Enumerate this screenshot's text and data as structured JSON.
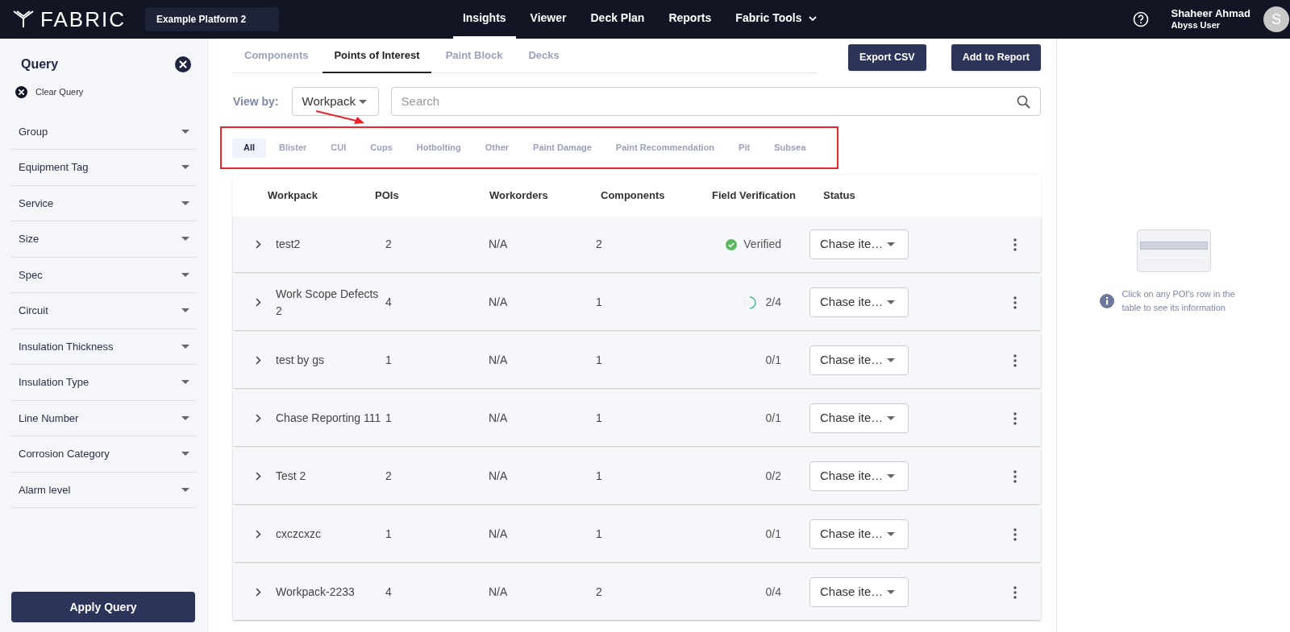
{
  "header": {
    "logo": "FABRIC",
    "platform": "Example Platform 2",
    "nav": [
      {
        "label": "Insights",
        "selected": true,
        "has_menu": false
      },
      {
        "label": "Viewer",
        "selected": false,
        "has_menu": false
      },
      {
        "label": "Deck Plan",
        "selected": false,
        "has_menu": false
      },
      {
        "label": "Reports",
        "selected": false,
        "has_menu": false
      },
      {
        "label": "Fabric Tools",
        "selected": false,
        "has_menu": true
      }
    ],
    "user": {
      "name": "Shaheer Ahmad",
      "role": "Abyss User",
      "initial": "S"
    }
  },
  "sidebar": {
    "title": "Query",
    "clear": "Clear Query",
    "filters": [
      "Group",
      "Equipment Tag",
      "Service",
      "Size",
      "Spec",
      "Circuit",
      "Insulation Thickness",
      "Insulation Type",
      "Line Number",
      "Corrosion Category",
      "Alarm level"
    ],
    "apply": "Apply Query"
  },
  "tabs": [
    {
      "label": "Components",
      "selected": false
    },
    {
      "label": "Points of Interest",
      "selected": true
    },
    {
      "label": "Paint Block",
      "selected": false
    },
    {
      "label": "Decks",
      "selected": false
    }
  ],
  "buttons": [
    "Export CSV",
    "Add to Report"
  ],
  "view_by": {
    "label": "View by:",
    "value": "Workpack"
  },
  "search": {
    "placeholder": "Search"
  },
  "categories": [
    {
      "label": "All",
      "selected": true
    },
    {
      "label": "Blister",
      "selected": false
    },
    {
      "label": "CUI",
      "selected": false
    },
    {
      "label": "Cups",
      "selected": false
    },
    {
      "label": "Hotbolting",
      "selected": false
    },
    {
      "label": "Other",
      "selected": false
    },
    {
      "label": "Paint Damage",
      "selected": false
    },
    {
      "label": "Paint Recommendation",
      "selected": false
    },
    {
      "label": "Pit",
      "selected": false
    },
    {
      "label": "Subsea",
      "selected": false
    }
  ],
  "table": {
    "columns": [
      "Workpack",
      "POIs",
      "Workorders",
      "Components",
      "Field Verification",
      "Status"
    ],
    "rows": [
      {
        "workpack": "test2",
        "pois": "2",
        "workorders": "N/A",
        "components": "2",
        "verification": {
          "kind": "verified",
          "text": "Verified"
        },
        "status": "Chase ite…"
      },
      {
        "workpack": "Work Scope Defects 2",
        "pois": "4",
        "workorders": "N/A",
        "components": "1",
        "verification": {
          "kind": "progress",
          "level": 0.5,
          "text": "2/4"
        },
        "status": "Chase ite…"
      },
      {
        "workpack": "test by gs",
        "pois": "1",
        "workorders": "N/A",
        "components": "1",
        "verification": {
          "kind": "progress",
          "text": "0/1"
        },
        "status": "Chase ite…"
      },
      {
        "workpack": "Chase Reporting 111",
        "pois": "1",
        "workorders": "N/A",
        "components": "1",
        "verification": {
          "kind": "progress",
          "text": "0/1"
        },
        "status": "Chase ite…"
      },
      {
        "workpack": "Test 2",
        "pois": "2",
        "workorders": "N/A",
        "components": "1",
        "verification": {
          "kind": "progress",
          "text": "0/2"
        },
        "status": "Chase ite…"
      },
      {
        "workpack": "cxczcxzc",
        "pois": "1",
        "workorders": "N/A",
        "components": "1",
        "verification": {
          "kind": "progress",
          "text": "0/1"
        },
        "status": "Chase ite…"
      },
      {
        "workpack": "Workpack-2233",
        "pois": "4",
        "workorders": "N/A",
        "components": "2",
        "verification": {
          "kind": "progress",
          "text": "0/4"
        },
        "status": "Chase ite…"
      }
    ]
  },
  "info_panel": {
    "message": "Click on any POI's row in the table to see its information"
  }
}
